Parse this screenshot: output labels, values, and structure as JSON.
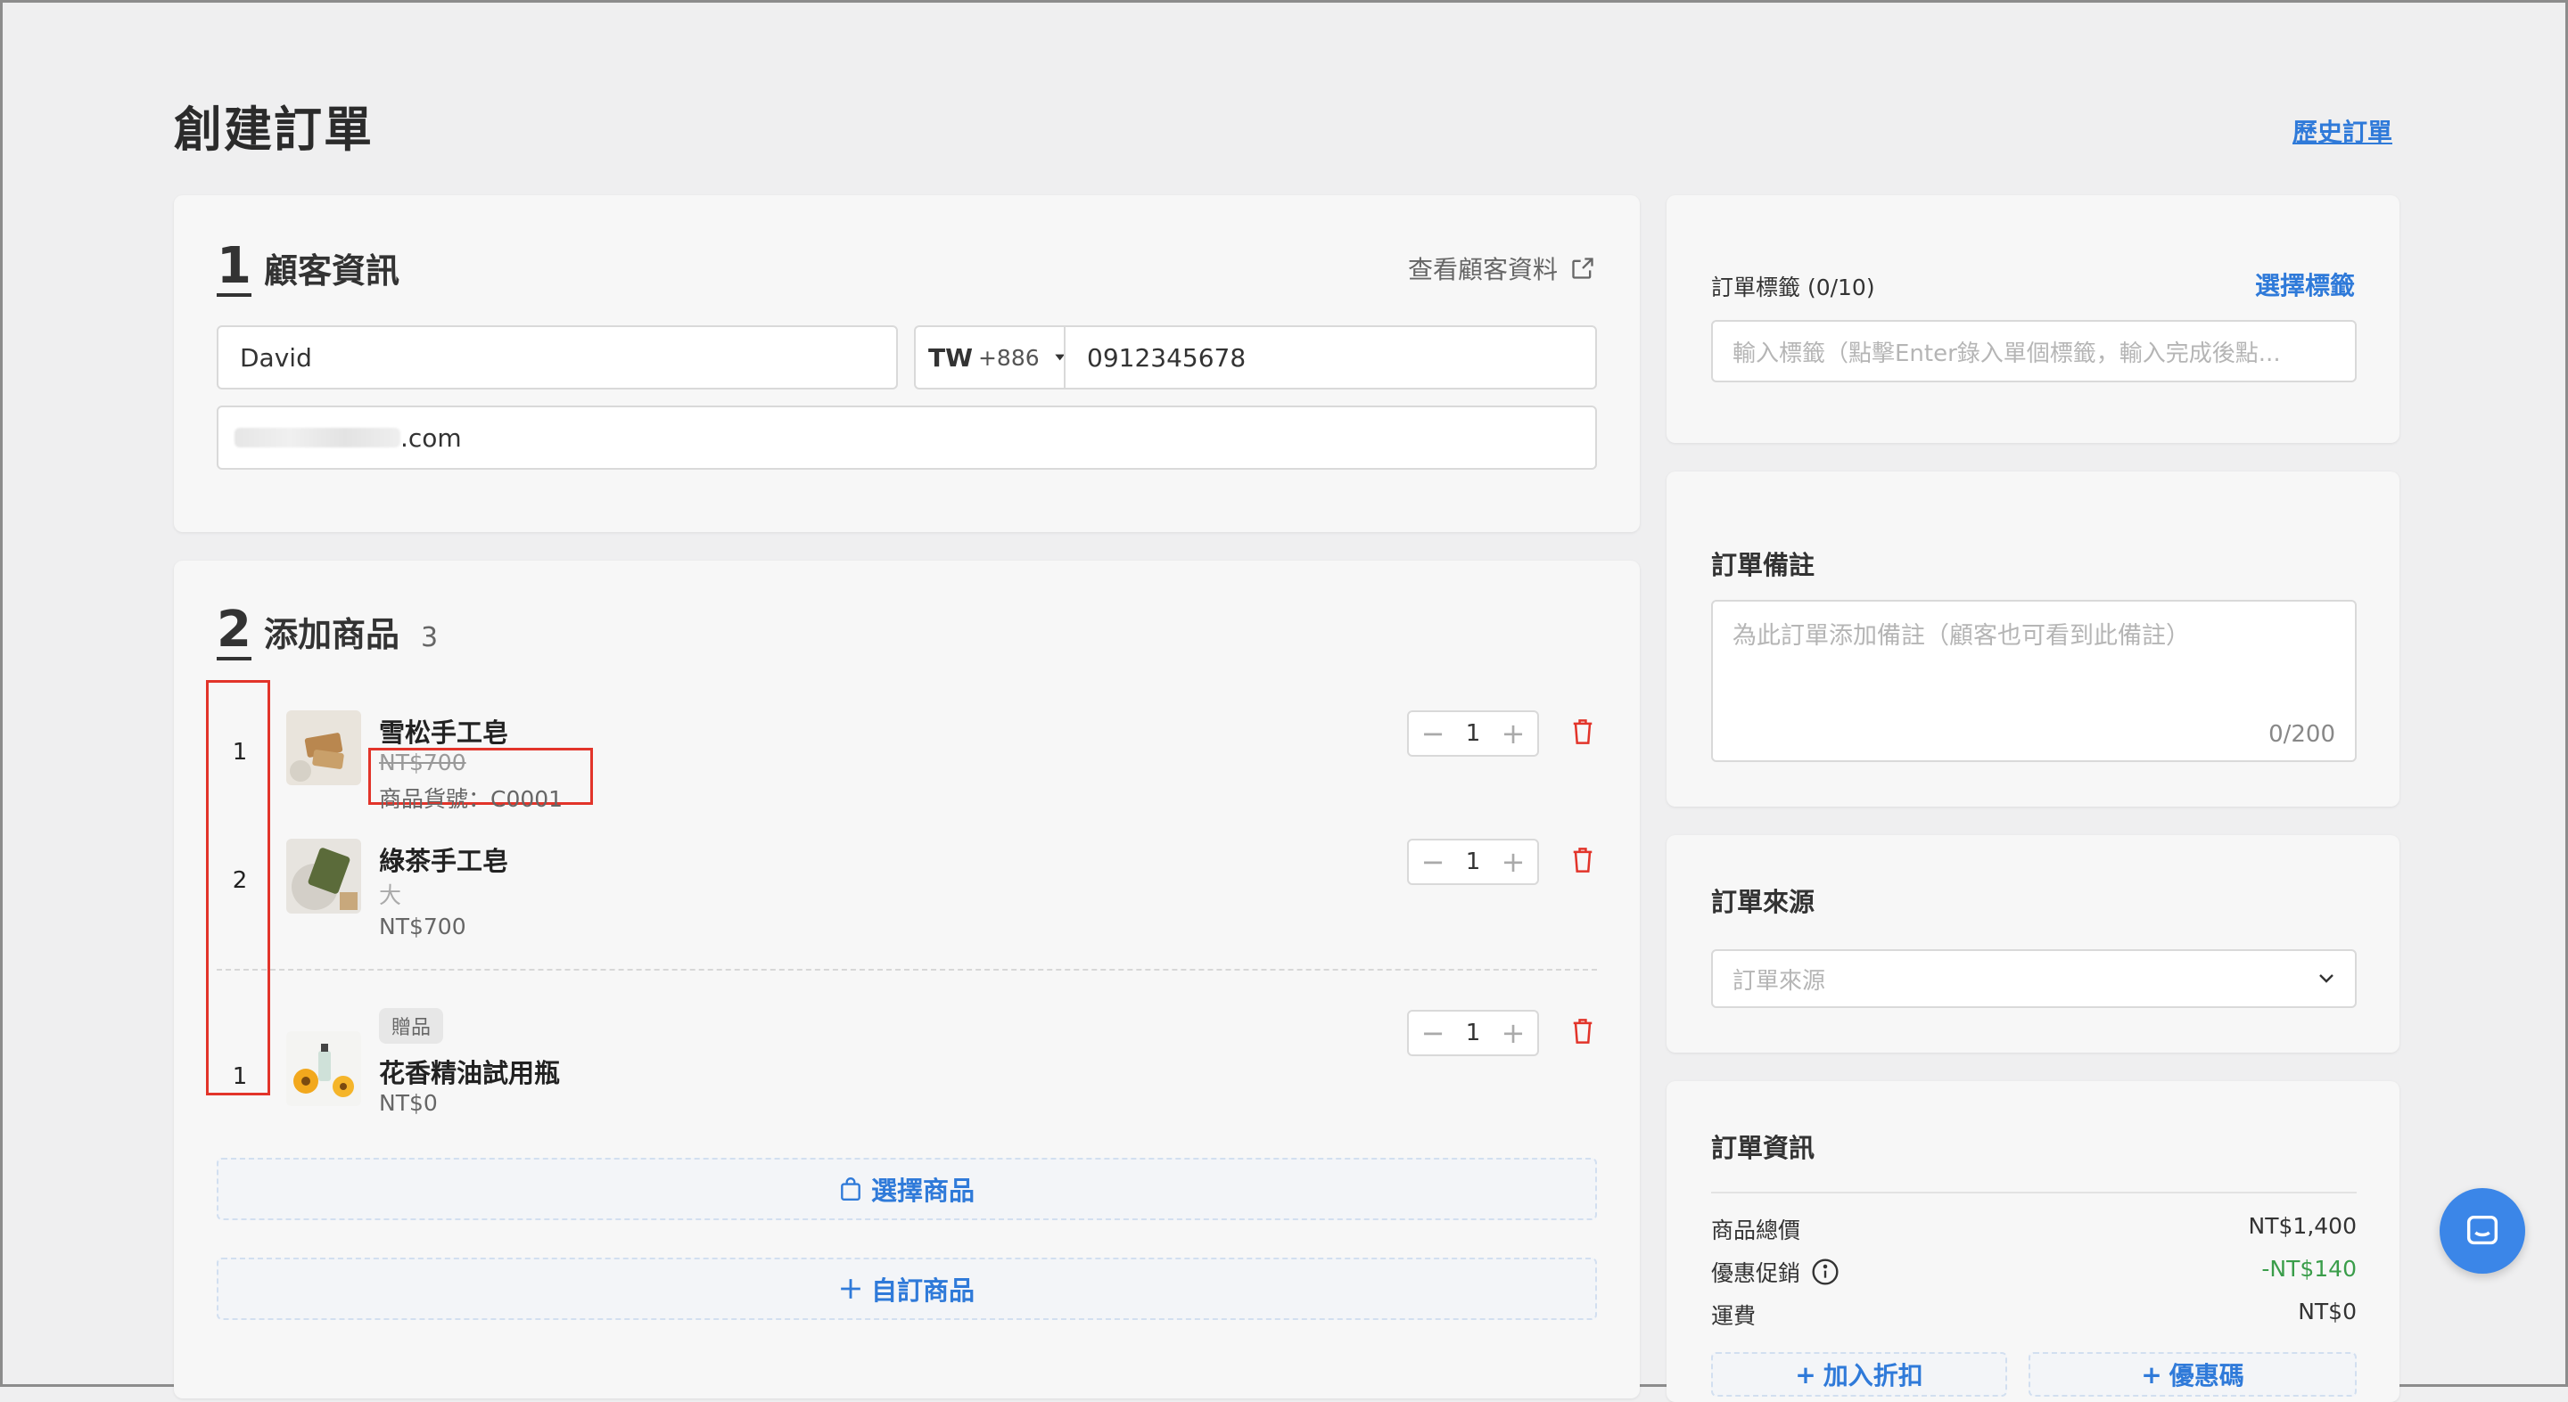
{
  "header": {
    "title": "創建訂單",
    "history_link": "歷史訂單"
  },
  "customer": {
    "section_number": "1",
    "section_title": "顧客資訊",
    "view_customer": "查看顧客資料",
    "name_value": "David",
    "country_code": "TW",
    "dial_code": "+886",
    "phone_value": "0912345678",
    "email_suffix": ".com"
  },
  "products": {
    "section_number": "2",
    "section_title": "添加商品",
    "count": "3",
    "items": [
      {
        "index": "1",
        "name": "雪松手工皂",
        "price": "NT$700",
        "sku": "商品貨號：C0001",
        "qty": "1"
      },
      {
        "index": "2",
        "name": "綠茶手工皂",
        "variant": "大",
        "price": "NT$700",
        "qty": "1"
      },
      {
        "index": "1",
        "tag": "贈品",
        "name": "花香精油試用瓶",
        "price": "NT$0",
        "qty": "1"
      }
    ],
    "select_products": "選擇商品",
    "custom_product": "自訂商品"
  },
  "tags": {
    "label": "訂單標籤 (0/10)",
    "select_label": "選擇標籤",
    "placeholder": "輸入標籤（點擊Enter錄入單個標籤，輸入完成後點..."
  },
  "notes": {
    "label": "訂單備註",
    "placeholder": "為此訂單添加備註（顧客也可看到此備註）",
    "counter": "0/200"
  },
  "source": {
    "label": "訂單來源",
    "placeholder": "訂單來源"
  },
  "order_info": {
    "label": "訂單資訊",
    "rows": [
      {
        "label": "商品總價",
        "value": "NT$1,400"
      },
      {
        "label": "優惠促銷",
        "value": "-NT$140"
      },
      {
        "label": "運費",
        "value": "NT$0"
      }
    ],
    "add_discount": "加入折扣",
    "coupon": "優惠碼"
  },
  "colors": {
    "accent": "#2f7ad9",
    "highlight_red": "#e2342a",
    "discount_green": "#3a9d4a"
  }
}
